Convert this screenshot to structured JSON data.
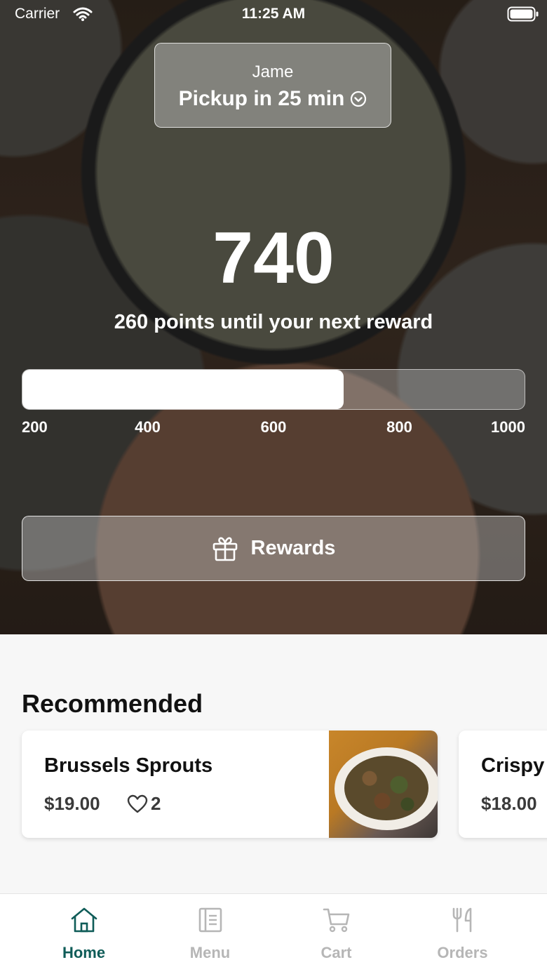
{
  "status_bar": {
    "carrier": "Carrier",
    "time": "11:25 AM"
  },
  "pickup": {
    "name": "Jame",
    "time_label": "Pickup in 25 min"
  },
  "loyalty": {
    "points": "740",
    "subtitle": "260 points until your next reward",
    "progress_fraction": 0.64,
    "ticks": [
      "200",
      "400",
      "600",
      "800",
      "1000"
    ]
  },
  "rewards_button": {
    "label": "Rewards",
    "icon": "gift-icon"
  },
  "recommended": {
    "title": "Recommended",
    "items": [
      {
        "name": "Brussels Sprouts",
        "price": "$19.00",
        "likes": "2"
      },
      {
        "name": "Crispy",
        "price": "$18.00"
      }
    ]
  },
  "tab_bar": {
    "tabs": [
      {
        "label": "Home",
        "icon": "home-icon",
        "active": true
      },
      {
        "label": "Menu",
        "icon": "menu-icon",
        "active": false
      },
      {
        "label": "Cart",
        "icon": "cart-icon",
        "active": false
      },
      {
        "label": "Orders",
        "icon": "utensils-icon",
        "active": false
      }
    ]
  },
  "colors": {
    "accent": "#0f5c58",
    "inactive_tab": "#b6b6b6",
    "background": "#f7f7f7"
  }
}
